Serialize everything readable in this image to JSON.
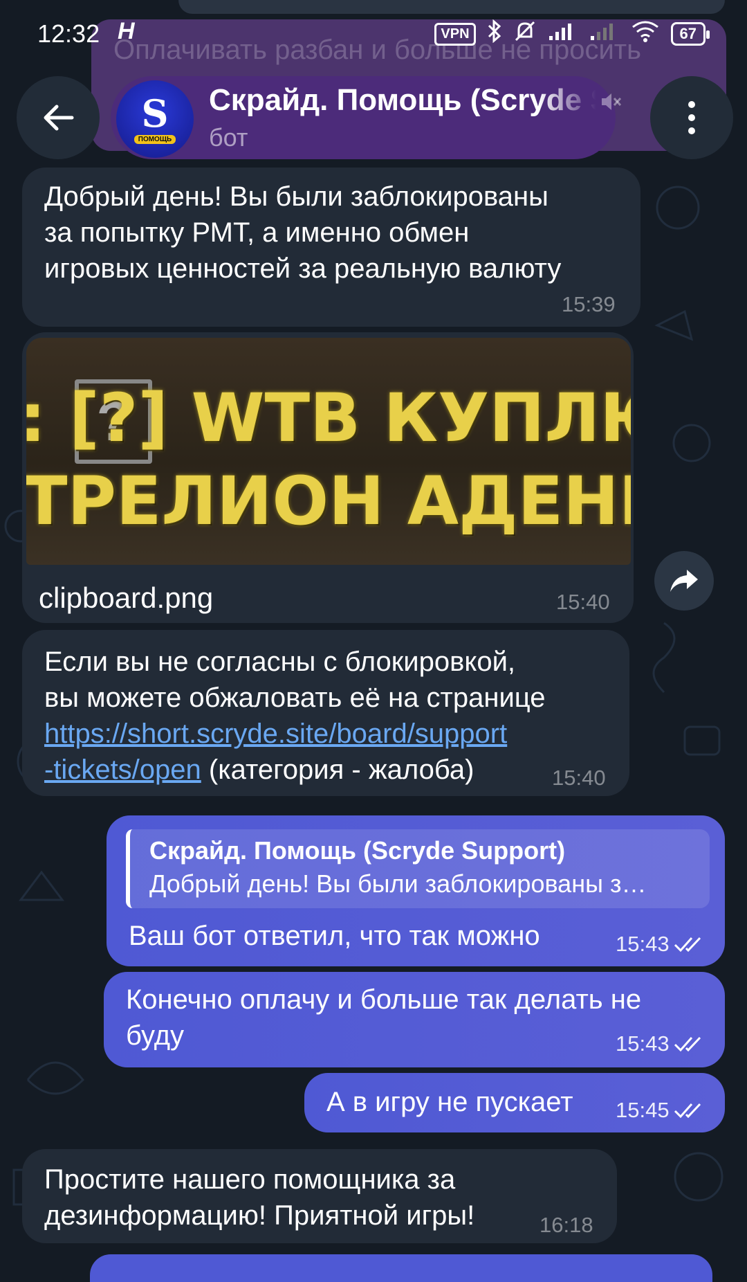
{
  "status_bar": {
    "time": "12:32",
    "h_icon": "H",
    "vpn": "VPN",
    "battery": "67",
    "icons": [
      "bluetooth-icon",
      "muted-bell-icon",
      "signal-icon",
      "signal-icon-2",
      "wifi-icon"
    ]
  },
  "ghost": {
    "text": "Оплачивать разбан и больше не просить"
  },
  "header": {
    "title": "Скрайд. Помощь (Scryde Support)",
    "subtitle": "бот",
    "avatar_letter": "S",
    "avatar_tag": "ПОМОЩЬ"
  },
  "messages": [
    {
      "id": "m1",
      "direction": "in",
      "lines": [
        "Добрый день! Вы были заблокированы",
        "за попытку РМТ, а именно обмен",
        "игровых ценностей за реальную валюту"
      ],
      "time": "15:39"
    },
    {
      "id": "m2",
      "direction": "in",
      "photo_text_1": ": [?]  WTB КУПЛЮ",
      "photo_text_2": "ТРЕЛИОН АДЕНЫ",
      "file_name": "clipboard.png",
      "time": "15:40"
    },
    {
      "id": "m3",
      "direction": "in",
      "line1": "Если вы не согласны с блокировкой,",
      "line2": "вы можете обжаловать её на странице",
      "link_part1": "https://short.scryde.site/board/support",
      "link_part2": "-tickets/open",
      "tail": " (категория - жалоба)",
      "time": "15:40"
    },
    {
      "id": "m4",
      "direction": "out",
      "reply_name": "Скрайд. Помощь (Scryde Support)",
      "reply_text": "Добрый день! Вы были заблокированы з…",
      "text": "Ваш бот ответил, что так можно",
      "time": "15:43"
    },
    {
      "id": "m5",
      "direction": "out",
      "lines": [
        "Конечно оплачу и больше так делать не",
        "буду"
      ],
      "time": "15:43"
    },
    {
      "id": "m6",
      "direction": "out",
      "text": "А в игру не пускает",
      "time": "15:45"
    },
    {
      "id": "m7",
      "direction": "in",
      "lines": [
        "Простите нашего помощника за",
        "дезинформацию! Приятной игры!"
      ],
      "time": "16:18"
    }
  ],
  "colors": {
    "background": "#141b24",
    "incoming_bubble": "#222b37",
    "outgoing_bubble": "#5058d6",
    "header_pill": "#4c2b7a",
    "link": "#6aa8f2"
  }
}
